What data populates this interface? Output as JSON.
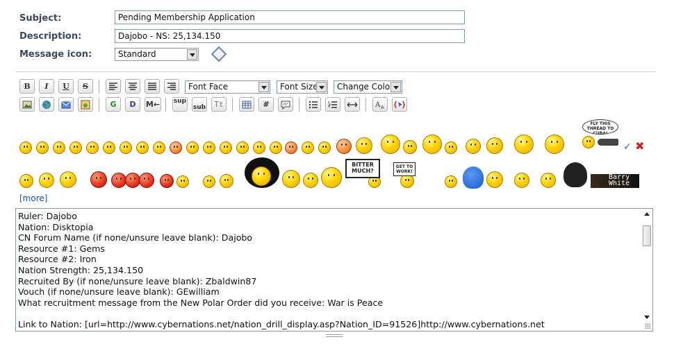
{
  "form": {
    "subject_label": "Subject:",
    "subject_value": "Pending Membership Application",
    "description_label": "Description:",
    "description_value": "Dajobo - NS: 25,134.150",
    "icon_label": "Message icon:",
    "icon_value": "Standard"
  },
  "toolbar": {
    "bold": "B",
    "italic": "I",
    "underline": "U",
    "strike": "S",
    "font_face": "Font Face",
    "font_size": "Font Size",
    "change_color": "Change Color",
    "glow": "G",
    "shadow": "D",
    "move": "M←",
    "sup": "sup",
    "sub": "sub",
    "teletype": "Tt",
    "hash": "#"
  },
  "smilies": {
    "more": "[more]",
    "signs": [
      "FLY THIS THREAD TO CUBA!",
      "BITTER MUCH?",
      "GET TO WORK!"
    ],
    "barry": "Barry White"
  },
  "editor": {
    "lines": [
      "Ruler: Dajobo",
      "Nation: Disktopia",
      "CN Forum Name (if none/unsure leave blank): Dajobo",
      "Resource #1: Gems",
      "Resource #2: Iron",
      "Nation Strength: 25,134.150",
      "Recruited By (if none/unsure leave blank): Zbaldwin87",
      "Vouch (if none/unsure leave blank): GEwilliam",
      "What recruitment message from the New Polar Order did you receive: War is Peace",
      "",
      "Link to Nation: [url=http://www.cybernations.net/nation_drill_display.asp?Nation_ID=91526]http://www.cybernations.net"
    ]
  }
}
